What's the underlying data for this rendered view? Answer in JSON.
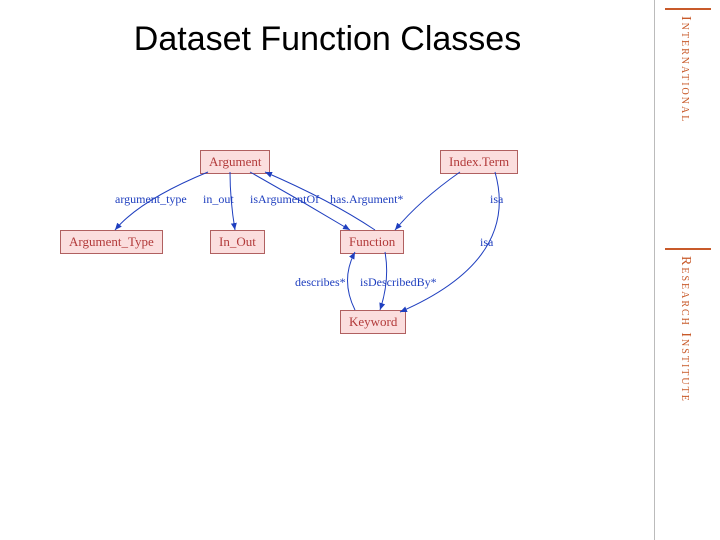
{
  "title": "Dataset Function Classes",
  "sidebar": {
    "line1": "International",
    "line2": "Research Institute"
  },
  "nodes": {
    "argument": "Argument",
    "index_term": "Index.Term",
    "argument_type": "Argument_Type",
    "in_out": "In_Out",
    "function": "Function",
    "keyword": "Keyword"
  },
  "edges": {
    "argument_type_lbl": "argument_type",
    "in_out_lbl": "in_out",
    "is_argument_of": "isArgumentOf",
    "has_argument": "has.Argument*",
    "isa1": "isa",
    "isa2": "isa",
    "describes": "describes*",
    "is_described_by": "isDescribedBy*"
  }
}
